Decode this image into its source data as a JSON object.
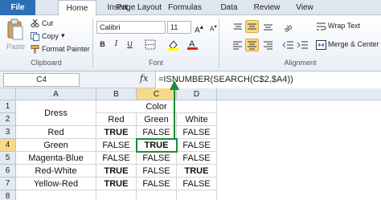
{
  "tabs": [
    "File",
    "Home",
    "Insert",
    "Page Layout",
    "Formulas",
    "Data",
    "Review",
    "View"
  ],
  "ribbon": {
    "clipboard": {
      "paste_label": "Paste",
      "cut_label": "Cut",
      "copy_label": "Copy",
      "format_painter_label": "Format Painter",
      "group_label": "Clipboard"
    },
    "font": {
      "font_name": "Calibri",
      "font_size": "11",
      "group_label": "Font"
    },
    "alignment": {
      "wrap_text_label": "Wrap Text",
      "merge_center_label": "Merge & Center",
      "group_label": "Alignment"
    }
  },
  "formula_bar": {
    "name_box": "C4",
    "fx": "fx",
    "formula": "=ISNUMBER(SEARCH(C$2,$A4))"
  },
  "grid": {
    "columns": [
      "A",
      "B",
      "C",
      "D"
    ],
    "rows": [
      "1",
      "2",
      "3",
      "4",
      "5",
      "6",
      "7",
      "8"
    ],
    "header_dress": "Dress",
    "header_color": "Color",
    "header_red": "Red",
    "header_green": "Green",
    "header_white": "White",
    "data": [
      {
        "dress": "Red",
        "red": "TRUE",
        "green": "FALSE",
        "white": "FALSE"
      },
      {
        "dress": "Green",
        "red": "FALSE",
        "green": "TRUE",
        "white": "FALSE"
      },
      {
        "dress": "Magenta-Blue",
        "red": "FALSE",
        "green": "FALSE",
        "white": "FALSE"
      },
      {
        "dress": "Red-White",
        "red": "TRUE",
        "green": "FALSE",
        "white": "TRUE"
      },
      {
        "dress": "Yellow-Red",
        "red": "TRUE",
        "green": "FALSE",
        "white": "FALSE"
      }
    ]
  },
  "colors": {
    "accent": "#2c6fb5",
    "active_cell_border": "#1e8a3a",
    "highlight": "#f7d98a"
  }
}
